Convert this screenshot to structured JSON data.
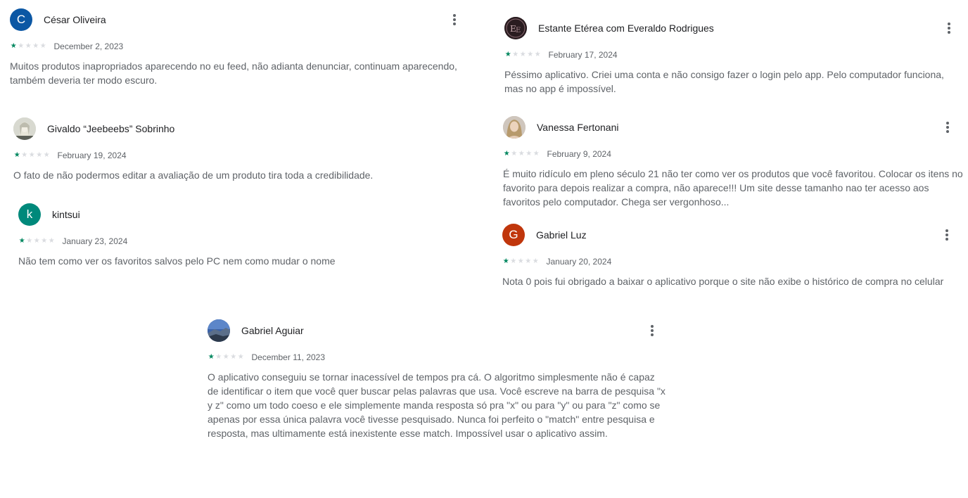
{
  "colors": {
    "star_filled": "#01875f",
    "star_empty": "#dadce0",
    "text_primary": "#202124",
    "text_secondary": "#5f6368"
  },
  "reviews": [
    {
      "author": "César Oliveira",
      "avatar": {
        "type": "initial",
        "text": "C",
        "color": "#0b57a4"
      },
      "rating": 1,
      "date": "December 2, 2023",
      "text": "Muitos produtos inapropriados aparecendo no eu feed, não adianta denunciar, continuam aparecendo, também deveria ter modo escuro."
    },
    {
      "author": "Givaldo “Jeebeebs” Sobrinho",
      "avatar": {
        "type": "photo",
        "icon": "anime-character-avatar-icon"
      },
      "rating": 1,
      "date": "February 19, 2024",
      "text": "O fato de não podermos editar a avaliação de um produto tira toda a credibilidade."
    },
    {
      "author": "kintsui",
      "avatar": {
        "type": "initial",
        "text": "k",
        "color": "#00897b"
      },
      "rating": 1,
      "date": "January 23, 2024",
      "text": "Não tem como ver os favoritos salvos pelo PC nem como mudar o nome"
    },
    {
      "author": "Estante Etérea com Everaldo Rodrigues",
      "avatar": {
        "type": "photo",
        "icon": "logo-avatar-icon"
      },
      "rating": 1,
      "date": "February 17, 2024",
      "text": "Péssimo aplicativo. Criei uma conta e não consigo fazer o login pelo app. Pelo computador funciona, mas no app é impossível."
    },
    {
      "author": "Vanessa Fertonani",
      "avatar": {
        "type": "photo",
        "icon": "person-photo-avatar-icon"
      },
      "rating": 1,
      "date": "February 9, 2024",
      "text": "É muito ridículo em pleno século 21 não ter como ver os produtos que você favoritou. Colocar os itens no favorito para depois realizar a compra, não aparece!!! Um site desse tamanho nao ter acesso aos favoritos pelo computador. Chega ser vergonhoso..."
    },
    {
      "author": "Gabriel Luz",
      "avatar": {
        "type": "initial",
        "text": "G",
        "color": "#c0360c"
      },
      "rating": 1,
      "date": "January 20, 2024",
      "text": "Nota 0 pois fui obrigado a baixar o aplicativo porque o site não exibe o histórico de compra no celular"
    },
    {
      "author": "Gabriel Aguiar",
      "avatar": {
        "type": "photo",
        "icon": "landscape-photo-avatar-icon"
      },
      "rating": 1,
      "date": "December 11, 2023",
      "text": "O aplicativo conseguiu se tornar inacessível de tempos pra cá. O algoritmo simplesmente não é capaz de identificar o item que você quer buscar pelas palavras que usa. Você escreve na barra de pesquisa \"x y z\" como um todo coeso e ele simplemente manda resposta só pra \"x\" ou para \"y\" ou para \"z\" como se apenas por essa única palavra você tivesse pesquisado. Nunca foi perfeito o \"match\" entre pesquisa e resposta, mas ultimamente está inexistente esse match. Impossível usar o aplicativo assim."
    }
  ]
}
